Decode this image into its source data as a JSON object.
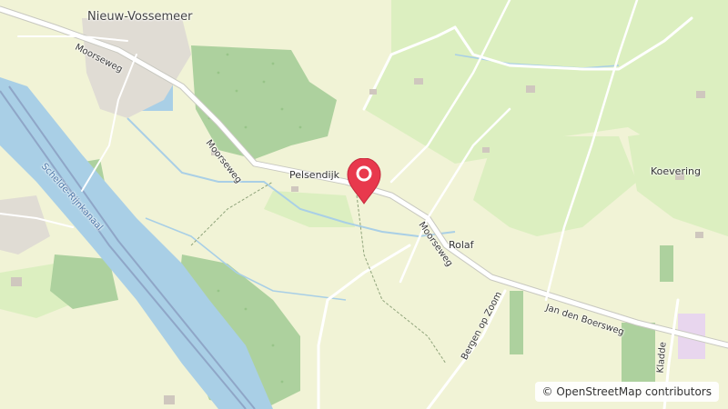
{
  "map": {
    "labels": {
      "town": "Nieuw-Vossemeer",
      "pelsendijk": "Pelsendijk",
      "moorseweg_1": "Moorseweg",
      "moorseweg_2": "Moorseweg",
      "moorseweg_3": "Moorseweg",
      "rolaf": "Rolaf",
      "koevering": "Koevering",
      "canal": "Schelde-Rijnkanaal",
      "jan_den_boersweg": "Jan den Boersweg",
      "bergen_op_zoom": "Bergen op Zoom",
      "kladde": "Kladde"
    },
    "attribution": "© OpenStreetMap contributors",
    "marker": {
      "color": "#e8394d",
      "icon": "location-pin-icon"
    },
    "colors": {
      "land": "#f1f3d6",
      "meadow": "#dcefc0",
      "forest": "#add19e",
      "water": "#a9cfe6",
      "road": "#ffffff",
      "road_casing": "#c8c8c0"
    }
  }
}
